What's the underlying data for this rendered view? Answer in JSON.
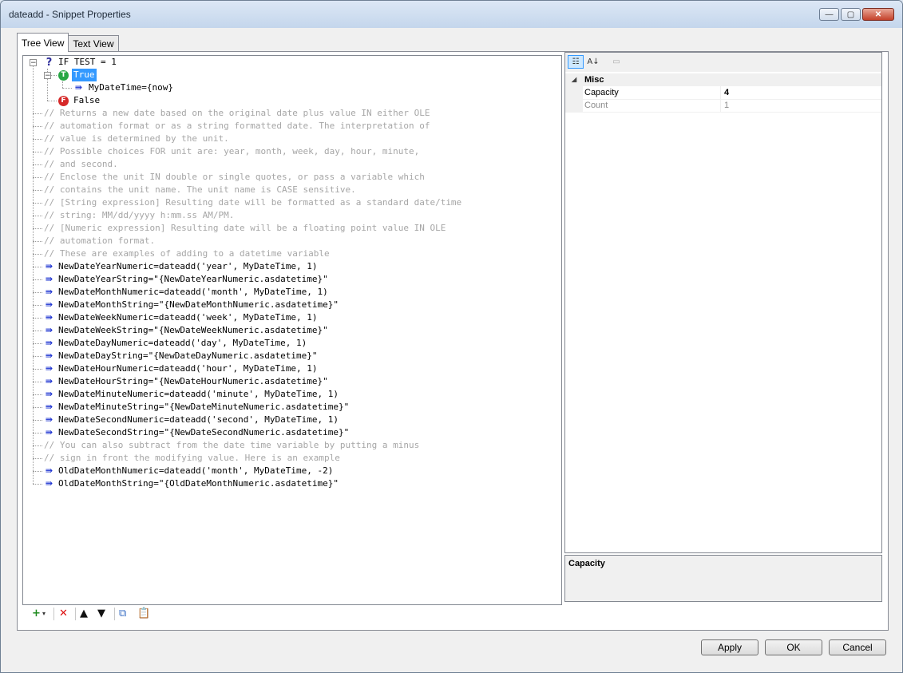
{
  "window": {
    "title": "dateadd - Snippet Properties",
    "controls": {
      "minimize": "—",
      "maximize": "▢",
      "close": "✕"
    }
  },
  "tabs": [
    {
      "label": "Tree View",
      "active": true
    },
    {
      "label": "Text View",
      "active": false
    }
  ],
  "tree": {
    "items": [
      {
        "type": "if",
        "text": "IF TEST = 1",
        "icon": "question-icon"
      },
      {
        "type": "true",
        "text": "True",
        "icon": "true-branch-icon",
        "selected": true
      },
      {
        "type": "assign",
        "text": "MyDateTime={now}",
        "icon": "assign-arrow-icon"
      },
      {
        "type": "false",
        "text": "False",
        "icon": "false-branch-icon"
      },
      {
        "type": "comment",
        "text": "// Returns a new date based on the original date plus value IN either OLE"
      },
      {
        "type": "comment",
        "text": "// automation format or as a string formatted date. The interpretation of"
      },
      {
        "type": "comment",
        "text": "// value is determined by the unit."
      },
      {
        "type": "comment",
        "text": "// Possible choices FOR unit are: year, month, week, day, hour, minute,"
      },
      {
        "type": "comment",
        "text": "// and second."
      },
      {
        "type": "comment",
        "text": "// Enclose the unit IN double or single quotes, or pass a variable which"
      },
      {
        "type": "comment",
        "text": "// contains the unit name. The unit name is CASE sensitive."
      },
      {
        "type": "comment",
        "text": "// [String expression] Resulting date will be formatted as a standard date/time"
      },
      {
        "type": "comment",
        "text": "// string: MM/dd/yyyy h:mm.ss AM/PM."
      },
      {
        "type": "comment",
        "text": "// [Numeric expression] Resulting date will be a floating point value IN OLE"
      },
      {
        "type": "comment",
        "text": "// automation format."
      },
      {
        "type": "comment",
        "text": "// These are examples of adding to a datetime variable"
      },
      {
        "type": "assign",
        "text": "NewDateYearNumeric=dateadd('year', MyDateTime, 1)"
      },
      {
        "type": "assign",
        "text": "NewDateYearString=\"{NewDateYearNumeric.asdatetime}\""
      },
      {
        "type": "assign",
        "text": "NewDateMonthNumeric=dateadd('month', MyDateTime, 1)"
      },
      {
        "type": "assign",
        "text": "NewDateMonthString=\"{NewDateMonthNumeric.asdatetime}\""
      },
      {
        "type": "assign",
        "text": "NewDateWeekNumeric=dateadd('week', MyDateTime, 1)"
      },
      {
        "type": "assign",
        "text": "NewDateWeekString=\"{NewDateWeekNumeric.asdatetime}\""
      },
      {
        "type": "assign",
        "text": "NewDateDayNumeric=dateadd('day', MyDateTime, 1)"
      },
      {
        "type": "assign",
        "text": "NewDateDayString=\"{NewDateDayNumeric.asdatetime}\""
      },
      {
        "type": "assign",
        "text": "NewDateHourNumeric=dateadd('hour', MyDateTime, 1)"
      },
      {
        "type": "assign",
        "text": "NewDateHourString=\"{NewDateHourNumeric.asdatetime}\""
      },
      {
        "type": "assign",
        "text": "NewDateMinuteNumeric=dateadd('minute', MyDateTime, 1)"
      },
      {
        "type": "assign",
        "text": "NewDateMinuteString=\"{NewDateMinuteNumeric.asdatetime}\""
      },
      {
        "type": "assign",
        "text": "NewDateSecondNumeric=dateadd('second', MyDateTime, 1)"
      },
      {
        "type": "assign",
        "text": "NewDateSecondString=\"{NewDateSecondNumeric.asdatetime}\""
      },
      {
        "type": "comment",
        "text": "// You can also subtract from the date time variable by putting a minus"
      },
      {
        "type": "comment",
        "text": "// sign in front the modifying value.  Here is an example"
      },
      {
        "type": "assign",
        "text": "OldDateMonthNumeric=dateadd('month', MyDateTime, -2)"
      },
      {
        "type": "assign",
        "text": "OldDateMonthString=\"{OldDateMonthNumeric.asdatetime}\""
      }
    ]
  },
  "property_grid": {
    "category": "Misc",
    "rows": [
      {
        "name": "Capacity",
        "value": "4",
        "bold": true
      },
      {
        "name": "Count",
        "value": "1",
        "bold": false
      }
    ],
    "description_title": "Capacity"
  },
  "buttons": {
    "apply": "Apply",
    "ok": "OK",
    "cancel": "Cancel"
  },
  "colors": {
    "selection": "#3399ff",
    "comment": "#a6a6a6",
    "assign_arrow": "#1a30d0"
  }
}
